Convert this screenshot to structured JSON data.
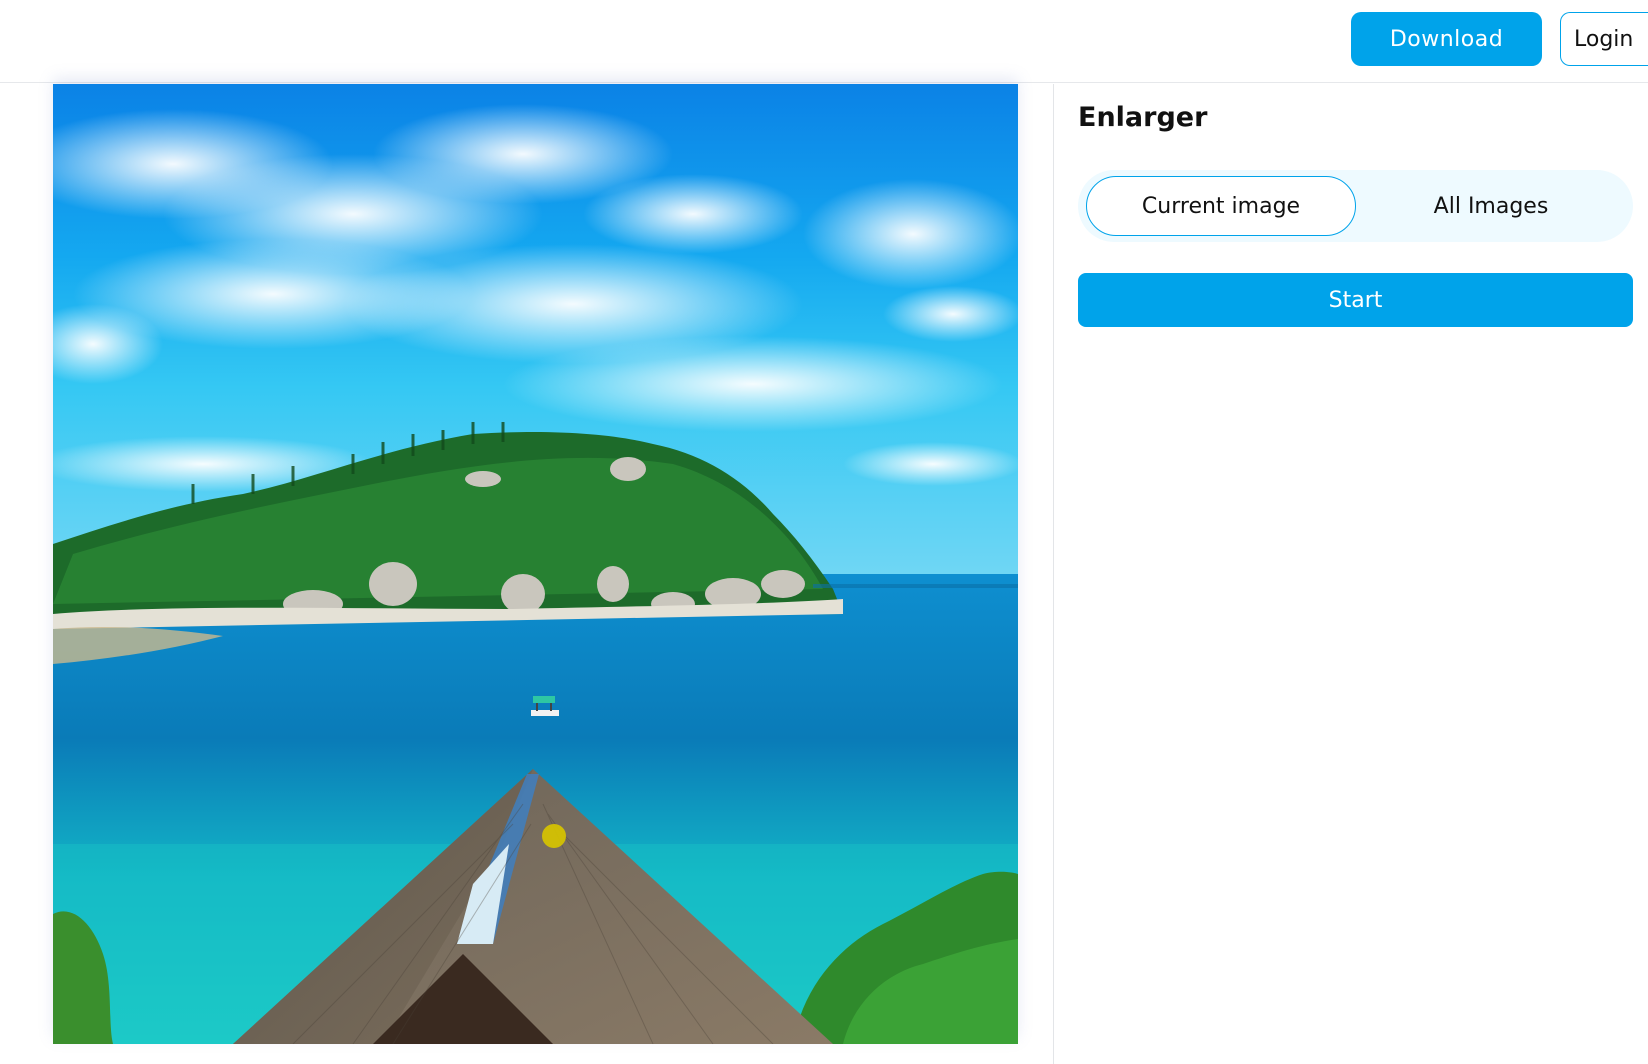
{
  "header": {
    "download_label": "Download",
    "login_label": "Login"
  },
  "panel": {
    "title": "Enlarger",
    "tabs": [
      {
        "label": "Current image",
        "selected": true
      },
      {
        "label": "All Images",
        "selected": false
      }
    ],
    "start_label": "Start"
  },
  "image": {
    "subject": "tropical-bay-photo"
  },
  "colors": {
    "accent": "#00a3ea",
    "segment_bg": "#eefaff",
    "cursor_dot": "#d7c400"
  }
}
